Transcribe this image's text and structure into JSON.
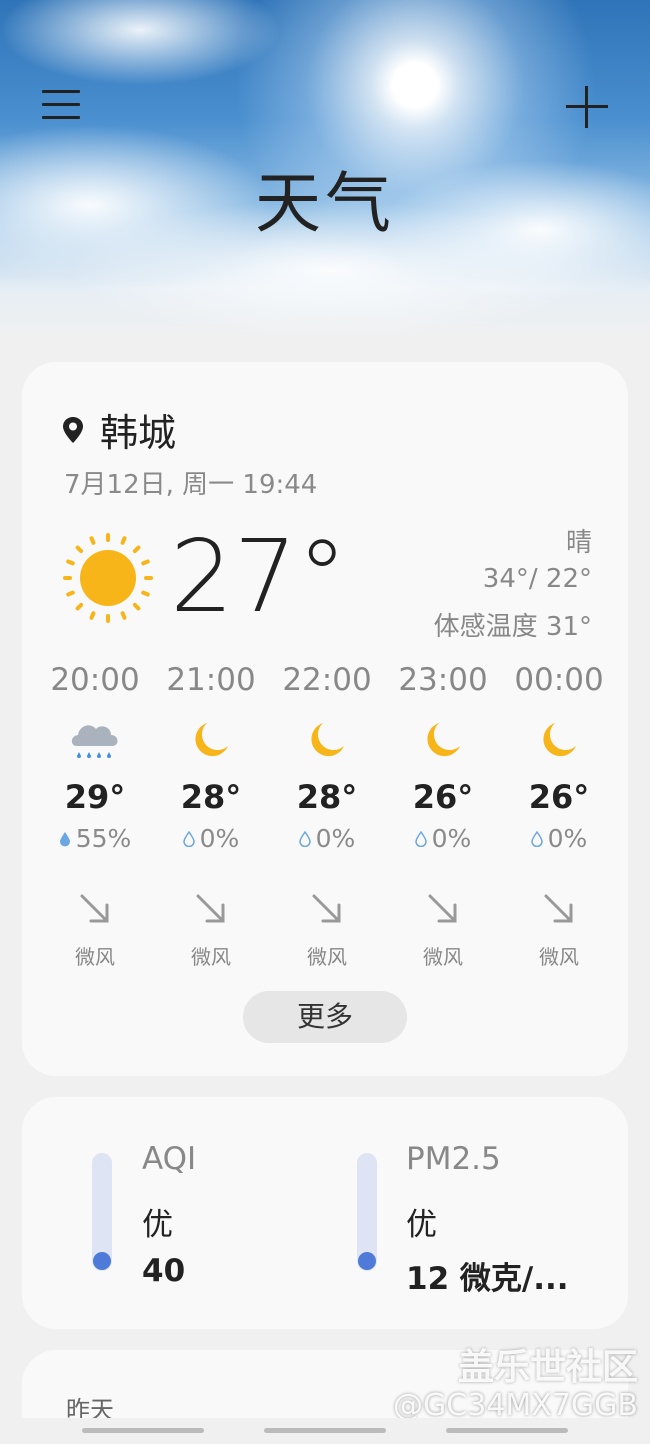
{
  "header": {
    "title": "天气"
  },
  "location": {
    "city": "韩城",
    "datetime": "7月12日, 周一 19:44"
  },
  "current": {
    "temperature": "27°",
    "condition": "晴",
    "high_low": "34°/ 22°",
    "feels_like": "体感温度 31°"
  },
  "hourly": [
    {
      "time": "20:00",
      "icon": "rain-cloud-icon",
      "temp": "29°",
      "rain": "55%",
      "wind": "微风"
    },
    {
      "time": "21:00",
      "icon": "moon-icon",
      "temp": "28°",
      "rain": "0%",
      "wind": "微风"
    },
    {
      "time": "22:00",
      "icon": "moon-icon",
      "temp": "28°",
      "rain": "0%",
      "wind": "微风"
    },
    {
      "time": "23:00",
      "icon": "moon-icon",
      "temp": "26°",
      "rain": "0%",
      "wind": "微风"
    },
    {
      "time": "00:00",
      "icon": "moon-icon",
      "temp": "26°",
      "rain": "0%",
      "wind": "微风"
    }
  ],
  "more_label": "更多",
  "air": [
    {
      "label": "AQI",
      "level": "优",
      "value": "40"
    },
    {
      "label": "PM2.5",
      "level": "优",
      "value": "12 微克/..."
    }
  ],
  "yesterday": {
    "label": "昨天"
  },
  "watermark": {
    "line1": "盖乐世社区",
    "line2": "@GC34MX7GGB"
  },
  "colors": {
    "sun": "#f7b519",
    "moon": "#f7b519",
    "gauge_fill": "#4f7bd8",
    "gauge_track": "#dfe4f4"
  }
}
